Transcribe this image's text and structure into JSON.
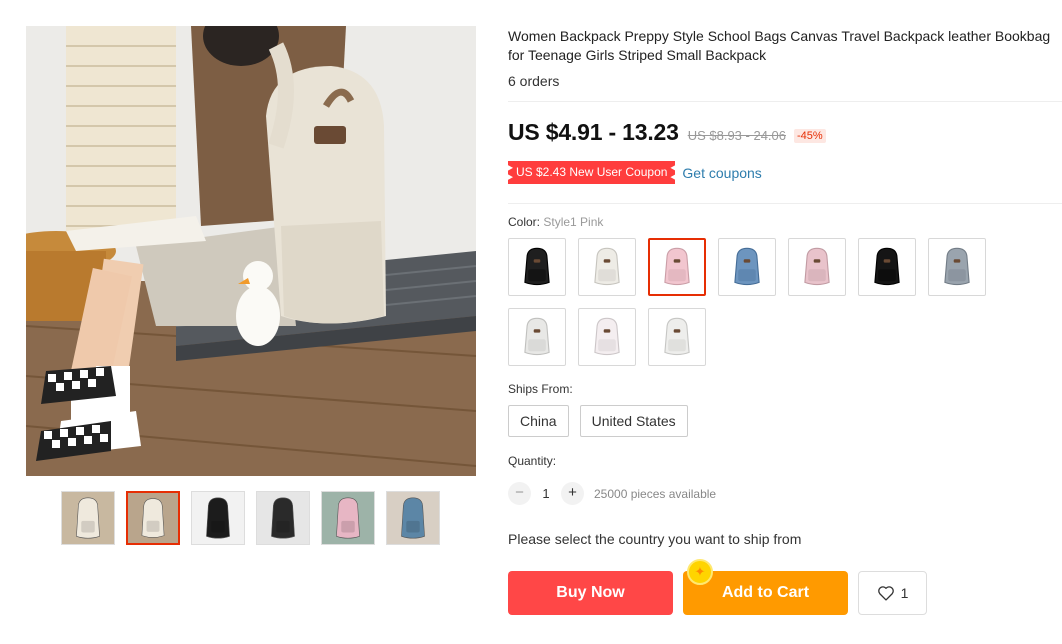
{
  "product": {
    "title": "Women Backpack Preppy Style School Bags Canvas Travel Backpack leather Bookbag for Teenage Girls Striped Small Backpack",
    "orders": "6 orders",
    "price": "US $4.91 - 13.23",
    "original_price": "US $8.93 - 24.06",
    "discount": "-45%"
  },
  "coupon": {
    "label": "US $2.43 New User Coupon",
    "get_coupons": "Get coupons"
  },
  "color": {
    "label": "Color:",
    "selected": "Style1 Pink",
    "options": [
      {
        "color": "#1f1f1f",
        "active": false
      },
      {
        "color": "#eeece6",
        "active": false
      },
      {
        "color": "#f2c6cf",
        "active": true
      },
      {
        "color": "#6d95bf",
        "active": false
      },
      {
        "color": "#e9c3cb",
        "active": false
      },
      {
        "color": "#151515",
        "active": false
      },
      {
        "color": "#9aa4ae",
        "active": false
      },
      {
        "color": "#e8e8e6",
        "active": false
      },
      {
        "color": "#f4eef0",
        "active": false
      },
      {
        "color": "#eeeeec",
        "active": false
      }
    ]
  },
  "ships": {
    "label": "Ships From:",
    "options": [
      "China",
      "United States"
    ]
  },
  "quantity": {
    "label": "Quantity:",
    "minus": "−",
    "value": "1",
    "plus": "+",
    "available": "25000 pieces available"
  },
  "notice": "Please select the country you want to ship from",
  "actions": {
    "buy_now": "Buy Now",
    "add_to_cart": "Add to Cart",
    "wishlist_count": "1"
  },
  "gallery": {
    "thumbs": [
      {
        "bg": "#c8b8a0",
        "bag": "#efe9dd",
        "active": false
      },
      {
        "bg": "#b9a58c",
        "bag": "#efe9dd",
        "active": true
      },
      {
        "bg": "#f2f2f2",
        "bag": "#1c1c1c",
        "active": false
      },
      {
        "bg": "#e6e6e6",
        "bag": "#2a2a2a",
        "active": false
      },
      {
        "bg": "#9db3a8",
        "bag": "#e7b6c4",
        "active": false
      },
      {
        "bg": "#d8cfc4",
        "bag": "#5c86a6",
        "active": false
      }
    ]
  },
  "icons": {
    "heart": "heart-icon",
    "coin": "coin-icon",
    "coin_glyph": "✦"
  }
}
